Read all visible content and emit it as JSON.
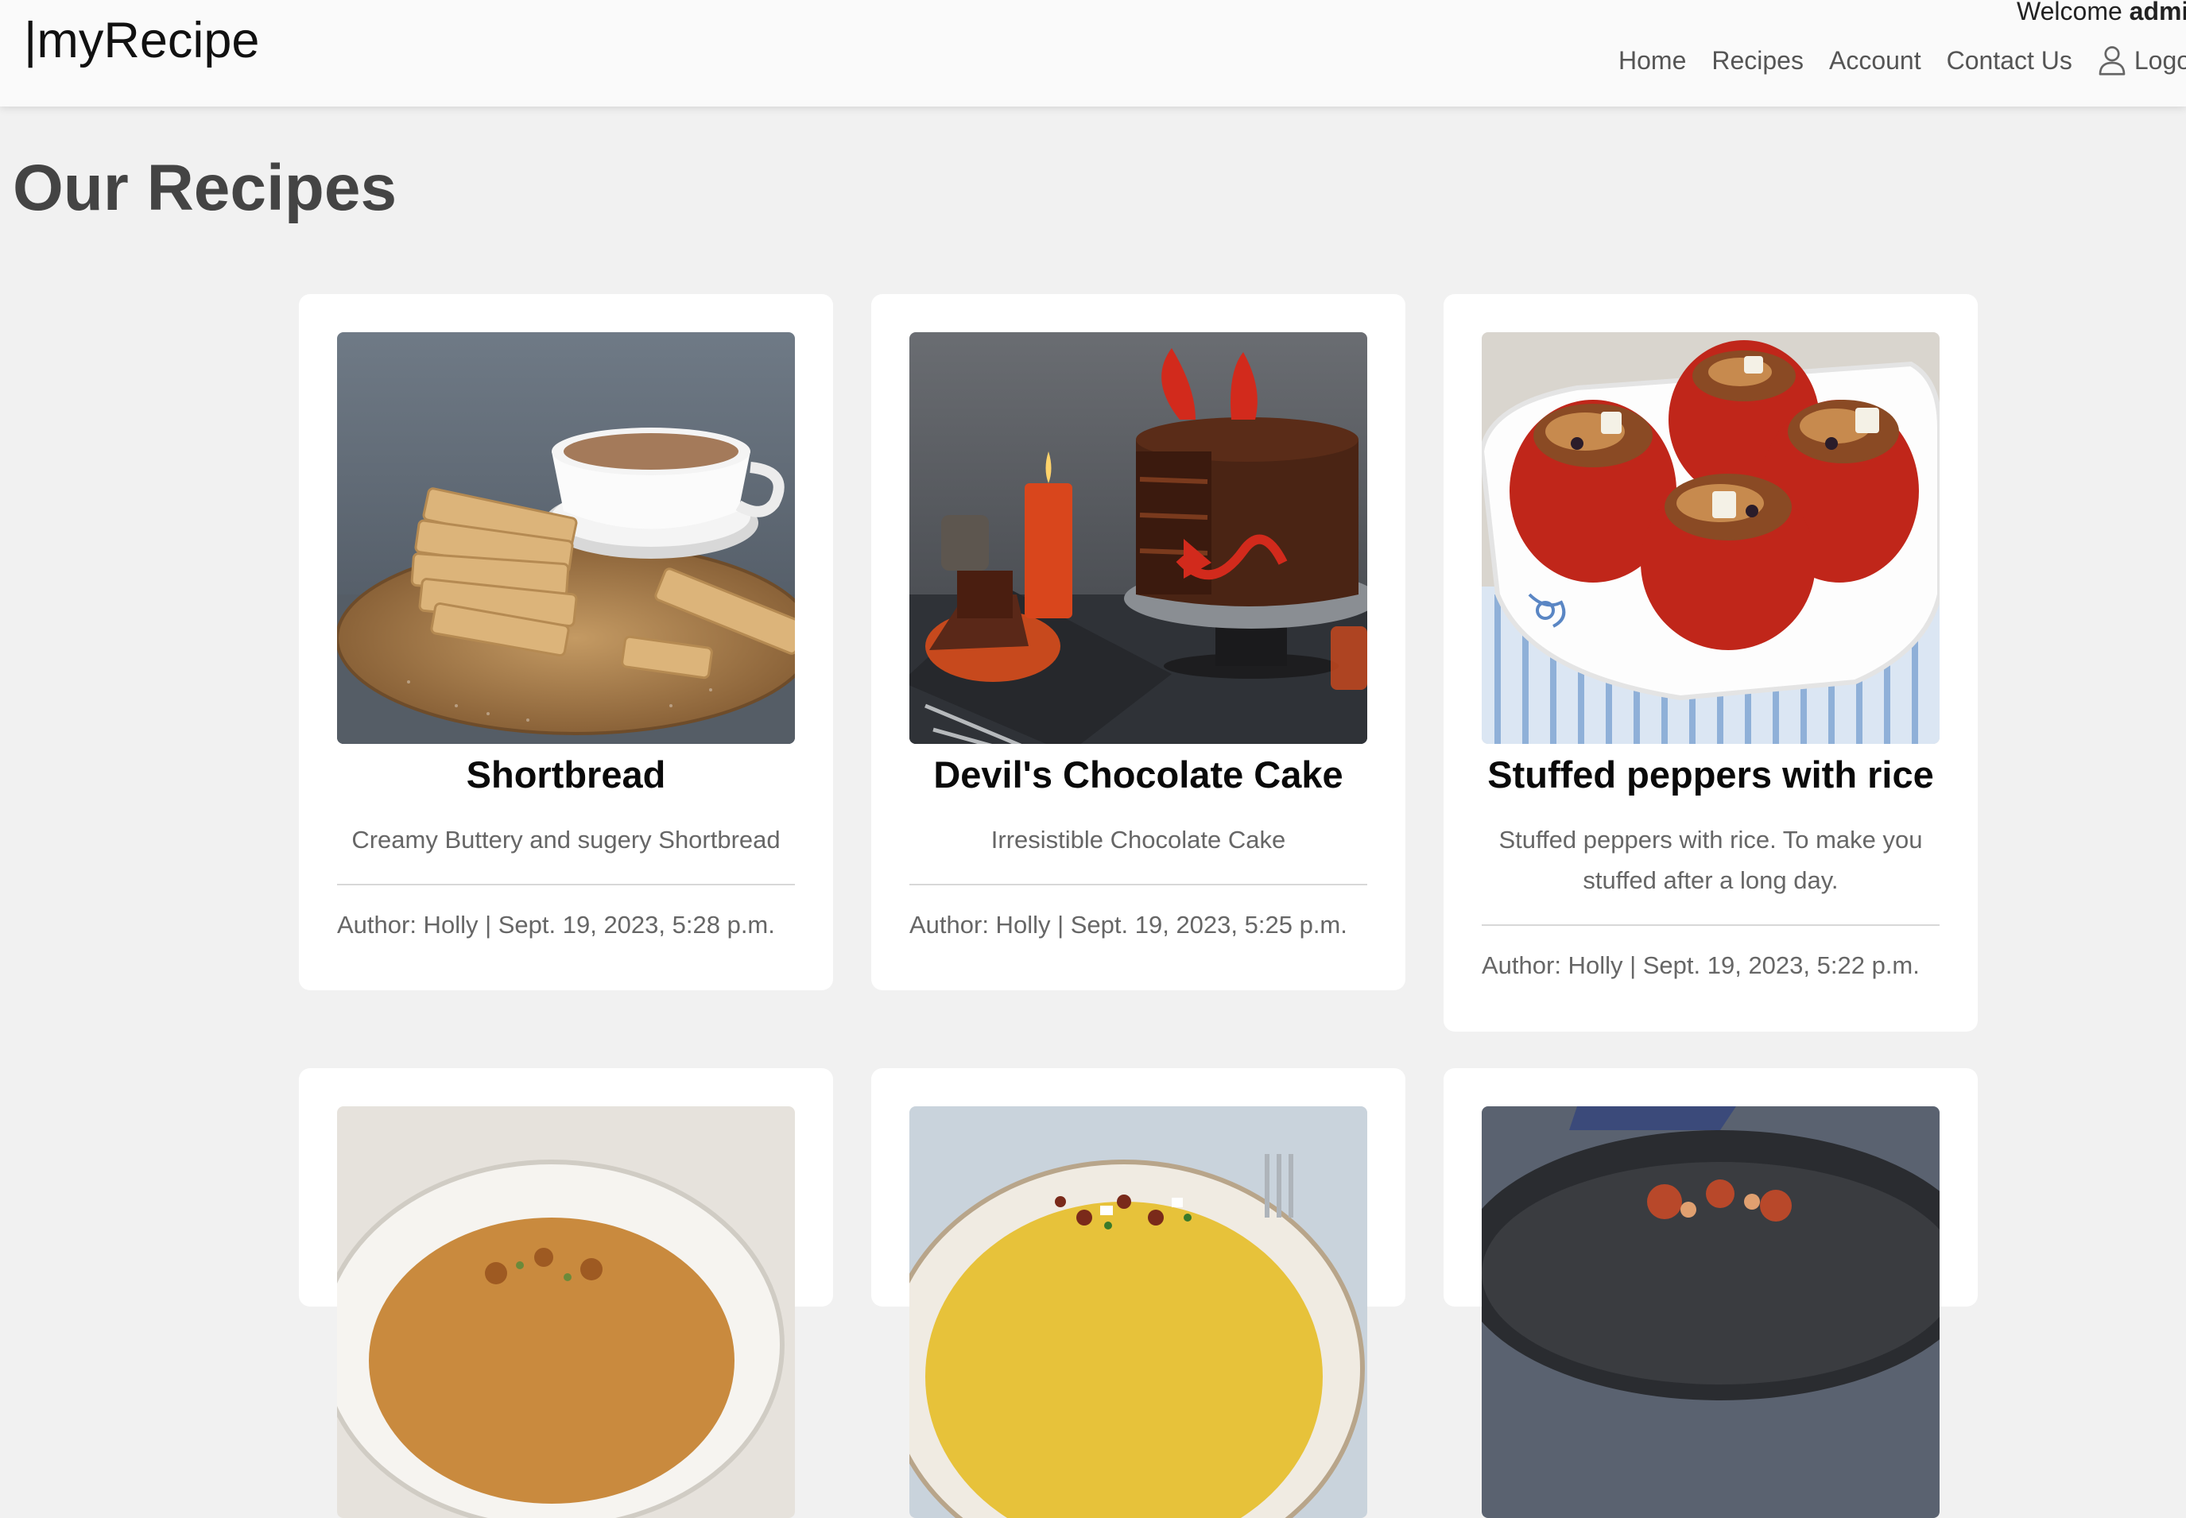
{
  "navbar": {
    "brand": "|myRecipe",
    "welcome_prefix": "Welcome ",
    "welcome_user": "admi",
    "links": [
      "Home",
      "Recipes",
      "Account",
      "Contact Us"
    ],
    "logout": "Logo",
    "logout_icon": "user-icon"
  },
  "page": {
    "title": "Our Recipes"
  },
  "recipes": [
    {
      "title": "Shortbread",
      "description": "Creamy Buttery and sugery Shortbread",
      "meta": "Author: Holly | Sept. 19, 2023, 5:28 p.m."
    },
    {
      "title": "Devil's Chocolate Cake",
      "description": "Irresistible Chocolate Cake",
      "meta": "Author: Holly | Sept. 19, 2023, 5:25 p.m."
    },
    {
      "title": "Stuffed peppers with rice",
      "description": "Stuffed peppers with rice. To make you stuffed after a long day.",
      "meta": "Author: Holly | Sept. 19, 2023, 5:22 p.m."
    }
  ],
  "colors": {
    "background": "#f1f1f1",
    "navbar": "#fafafa",
    "card": "#ffffff"
  }
}
